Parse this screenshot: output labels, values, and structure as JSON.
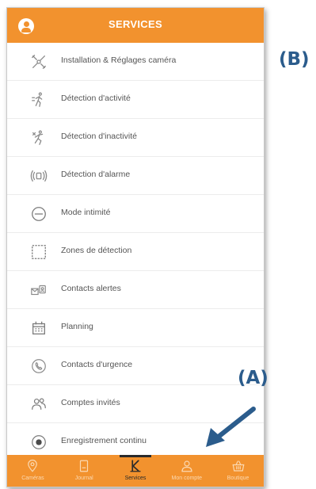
{
  "header": {
    "title": "SERVICES"
  },
  "menu": {
    "items": [
      {
        "label": "Installation & Réglages caméra",
        "icon": "tools-icon"
      },
      {
        "label": "Détection d'activité",
        "icon": "activity-icon"
      },
      {
        "label": "Détection d'inactivité",
        "icon": "inactivity-icon"
      },
      {
        "label": "Détection d'alarme",
        "icon": "alarm-waves-icon"
      },
      {
        "label": "Mode intimité",
        "icon": "minus-circle-icon"
      },
      {
        "label": "Zones de détection",
        "icon": "dashed-square-icon"
      },
      {
        "label": "Contacts alertes",
        "icon": "contacts-alert-icon"
      },
      {
        "label": "Planning",
        "icon": "calendar-icon"
      },
      {
        "label": "Contacts d'urgence",
        "icon": "phone-circle-icon"
      },
      {
        "label": "Comptes invités",
        "icon": "guests-icon"
      },
      {
        "label": "Enregistrement continu",
        "icon": "record-icon"
      }
    ]
  },
  "tabbar": {
    "tabs": [
      {
        "label": "Caméras",
        "icon": "camera-pin-icon",
        "active": false
      },
      {
        "label": "Journal",
        "icon": "journal-icon",
        "active": false
      },
      {
        "label": "Services",
        "icon": "services-k-icon",
        "active": true
      },
      {
        "label": "Mon compte",
        "icon": "account-icon",
        "active": false
      },
      {
        "label": "Boutique",
        "icon": "basket-icon",
        "active": false
      }
    ]
  },
  "annotations": {
    "a": "(A)",
    "b": "(B)"
  },
  "colors": {
    "brand": "#f2922e",
    "annotation": "#2b5c8c"
  }
}
